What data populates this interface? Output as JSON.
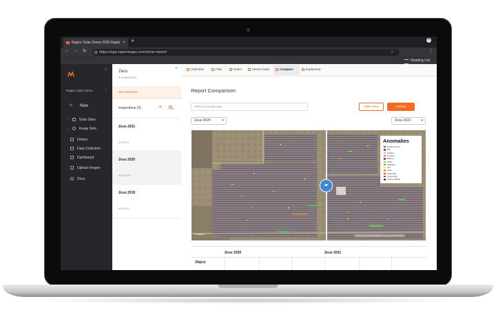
{
  "browser": {
    "tab_title": "Raptor Solar Demo 2020-Rapto",
    "tab_close": "×",
    "new_tab": "+",
    "url": "https://app.raptormaps.com/solar-report/",
    "reading_list": "Reading List"
  },
  "sidebar": {
    "org_name": "Raptor Solar Demo",
    "new_label": "New",
    "items": [
      {
        "label": "Solar Sites",
        "icon": "solar-site-icon",
        "expandable": true
      },
      {
        "label": "Image Sets",
        "icon": "image-set-icon",
        "expandable": true
      },
      {
        "label": "Orders",
        "icon": "orders-icon",
        "expandable": false
      },
      {
        "label": "Data Collection",
        "icon": "data-collection-icon",
        "expandable": false
      },
      {
        "label": "Dashboard",
        "icon": "dashboard-icon",
        "expandable": false
      },
      {
        "label": "Upload Images",
        "icon": "upload-icon",
        "expandable": false
      },
      {
        "label": "Docs",
        "icon": "docs-icon",
        "expandable": false
      }
    ]
  },
  "inspections_panel": {
    "site_name": "Zeus",
    "inspection_count": "3 Inspections",
    "site_overview": "Site Overview",
    "inspections_label": "Inspections (3)",
    "inspections": [
      {
        "name": "Zeus 2021",
        "date": "6/3/2021",
        "selected": false
      },
      {
        "name": "Zeus 2020",
        "date": "6/30/2020",
        "selected": true
      },
      {
        "name": "Zeus 2019",
        "date": "6/4/2019",
        "selected": false
      }
    ]
  },
  "subnav": {
    "tabs": [
      {
        "label": "Overview",
        "active": false
      },
      {
        "label": "Files",
        "active": false
      },
      {
        "label": "Notes",
        "active": false
      },
      {
        "label": "Sensor Data",
        "active": false
      },
      {
        "label": "Compare",
        "active": true
      },
      {
        "label": "Equipment",
        "active": false
      }
    ]
  },
  "report": {
    "title": "Report Comparison",
    "anomaly_placeholder": "Select anomaly type",
    "table_view_label": "Table View",
    "actions_label": "Actions",
    "left_inspection": "Zeus 2020",
    "right_inspection": "Zeus 2021"
  },
  "map": {
    "legend_title": "Anomalies",
    "legend_items": [
      {
        "label": "Equipment Pad",
        "color": "#2e7d32"
      },
      {
        "label": "PID",
        "color": "#9c27b0"
      },
      {
        "label": "Shading",
        "color": "#e6c629"
      },
      {
        "label": "Cracking",
        "color": "#29b6f6"
      },
      {
        "label": "Missing",
        "color": "#e91e63"
      },
      {
        "label": "Soiling",
        "color": "#8bc34a"
      },
      {
        "label": "Vegetation",
        "color": "#4caf50"
      },
      {
        "label": "Cell",
        "color": "#ffeb3b"
      },
      {
        "label": "Diode",
        "color": "#ff9800"
      },
      {
        "label": "Diode Multi",
        "color": "#f44336"
      },
      {
        "label": "Junction Box",
        "color": "#795548"
      },
      {
        "label": "Reverse Polarity",
        "color": "#673ab7"
      }
    ],
    "mapbox_logo": "mapbox",
    "attribution": "© Mapbox © OpenStreetMap Improve this map © Maxar"
  },
  "compare_table": {
    "col_left": "Zeus 2020",
    "col_right": "Zeus 2021",
    "row_label": "Object"
  },
  "colors": {
    "accent": "#f26b21",
    "sidebar_bg": "#26272a",
    "browser_chrome": "#35363a"
  }
}
